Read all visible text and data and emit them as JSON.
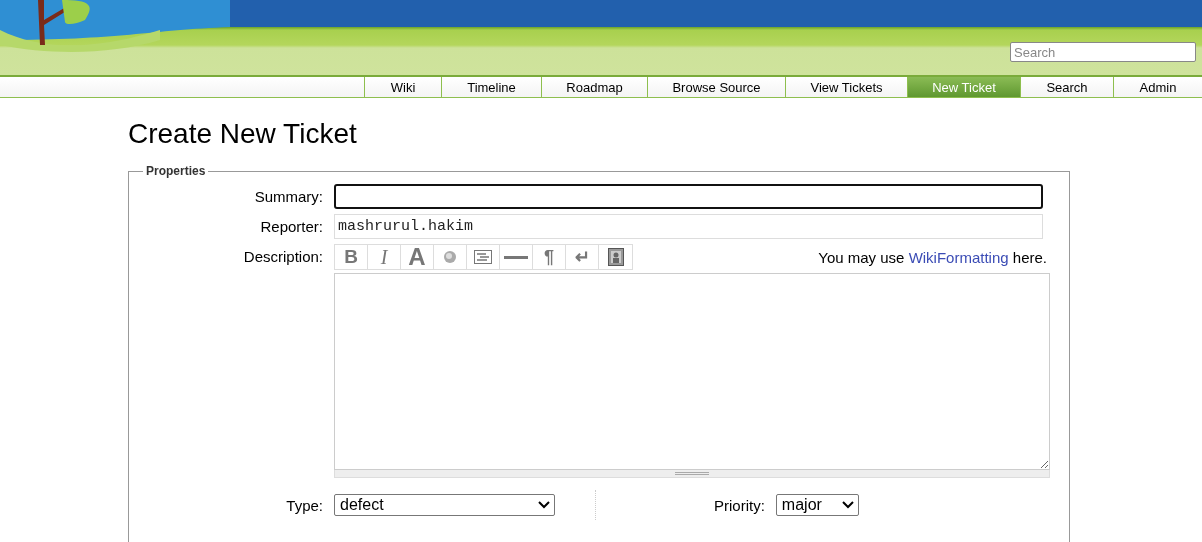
{
  "header": {
    "search": {
      "placeholder": "Search"
    }
  },
  "nav": [
    {
      "label": "Wiki",
      "selected": false
    },
    {
      "label": "Timeline",
      "selected": false
    },
    {
      "label": "Roadmap",
      "selected": false
    },
    {
      "label": "Browse Source",
      "selected": false
    },
    {
      "label": "View Tickets",
      "selected": false
    },
    {
      "label": "New Ticket",
      "selected": true
    },
    {
      "label": "Search",
      "selected": false
    },
    {
      "label": "Admin",
      "selected": false
    }
  ],
  "title": "Create New Ticket",
  "properties": {
    "legend": "Properties",
    "summary": {
      "label": "Summary:"
    },
    "reporter": {
      "label": "Reporter:",
      "value": "mashrurul.hakim"
    },
    "description": {
      "label": "Description:",
      "hint_before": "You may use ",
      "hint_link": "WikiFormatting",
      "hint_after": " here.",
      "toolbar": [
        {
          "kind": "bold",
          "label": "B"
        },
        {
          "kind": "italic",
          "label": "I"
        },
        {
          "kind": "heading",
          "label": "A"
        },
        {
          "kind": "globe"
        },
        {
          "kind": "codeblock"
        },
        {
          "kind": "rule"
        },
        {
          "kind": "glyph",
          "label": "¶"
        },
        {
          "kind": "glyph",
          "label": "↵"
        },
        {
          "kind": "portrait"
        }
      ]
    },
    "type": {
      "label": "Type:",
      "value": "defect"
    },
    "priority": {
      "label": "Priority:",
      "value": "major"
    }
  }
}
